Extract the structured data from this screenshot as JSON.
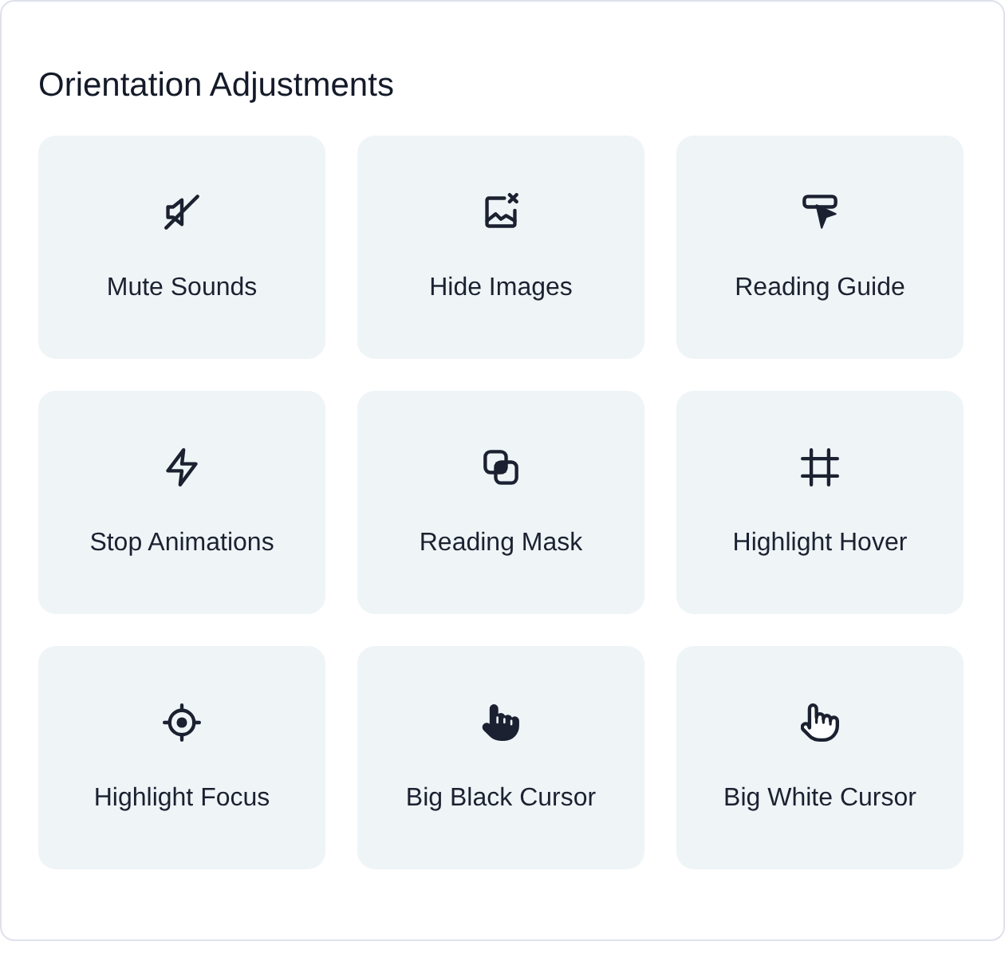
{
  "panel": {
    "title": "Orientation Adjustments"
  },
  "options": [
    {
      "label": "Mute Sounds"
    },
    {
      "label": "Hide Images"
    },
    {
      "label": "Reading Guide"
    },
    {
      "label": "Stop Animations"
    },
    {
      "label": "Reading Mask"
    },
    {
      "label": "Highlight Hover"
    },
    {
      "label": "Highlight Focus"
    },
    {
      "label": "Big Black Cursor"
    },
    {
      "label": "Big White Cursor"
    }
  ]
}
